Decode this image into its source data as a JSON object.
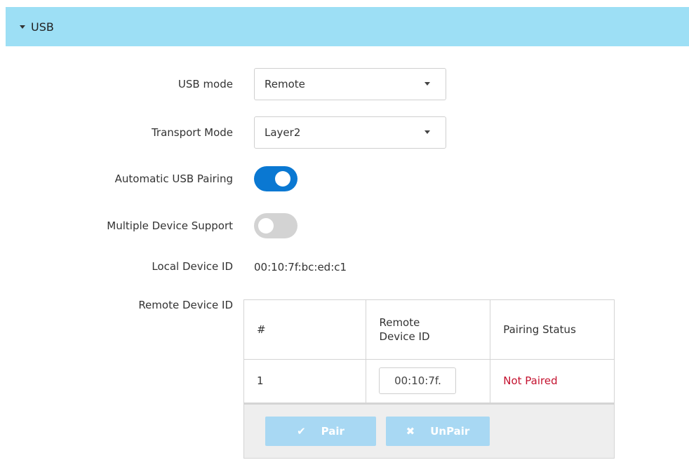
{
  "section": {
    "title": "USB",
    "icon": "caret-down-icon",
    "header_color": "#9ddff5"
  },
  "usb_mode": {
    "label": "USB mode",
    "value": "Remote",
    "icon": "dropdown-arrow-icon"
  },
  "transport_mode": {
    "label": "Transport Mode",
    "value": "Layer2",
    "icon": "dropdown-arrow-icon"
  },
  "auto_pairing": {
    "label": "Automatic USB Pairing",
    "enabled": true,
    "on_color": "#0a78d2"
  },
  "multi_device": {
    "label": "Multiple Device Support",
    "enabled": false,
    "off_color": "#d3d3d3"
  },
  "local_device": {
    "label": "Local Device ID",
    "value": "00:10:7f:bc:ed:c1"
  },
  "remote_device": {
    "label": "Remote Device ID",
    "table": {
      "headers": [
        "#",
        "Remote Device ID",
        "Pairing Status"
      ],
      "rows": [
        {
          "index": "1",
          "device_id": "00:10:7f.",
          "status": "Not Paired"
        }
      ]
    },
    "status_color": "#c4122f"
  },
  "actions": {
    "pair_label": "Pair",
    "pair_icon": "checkmark-icon",
    "unpair_label": "UnPair",
    "unpair_icon": "x-icon",
    "button_color": "#a8d8f3"
  }
}
